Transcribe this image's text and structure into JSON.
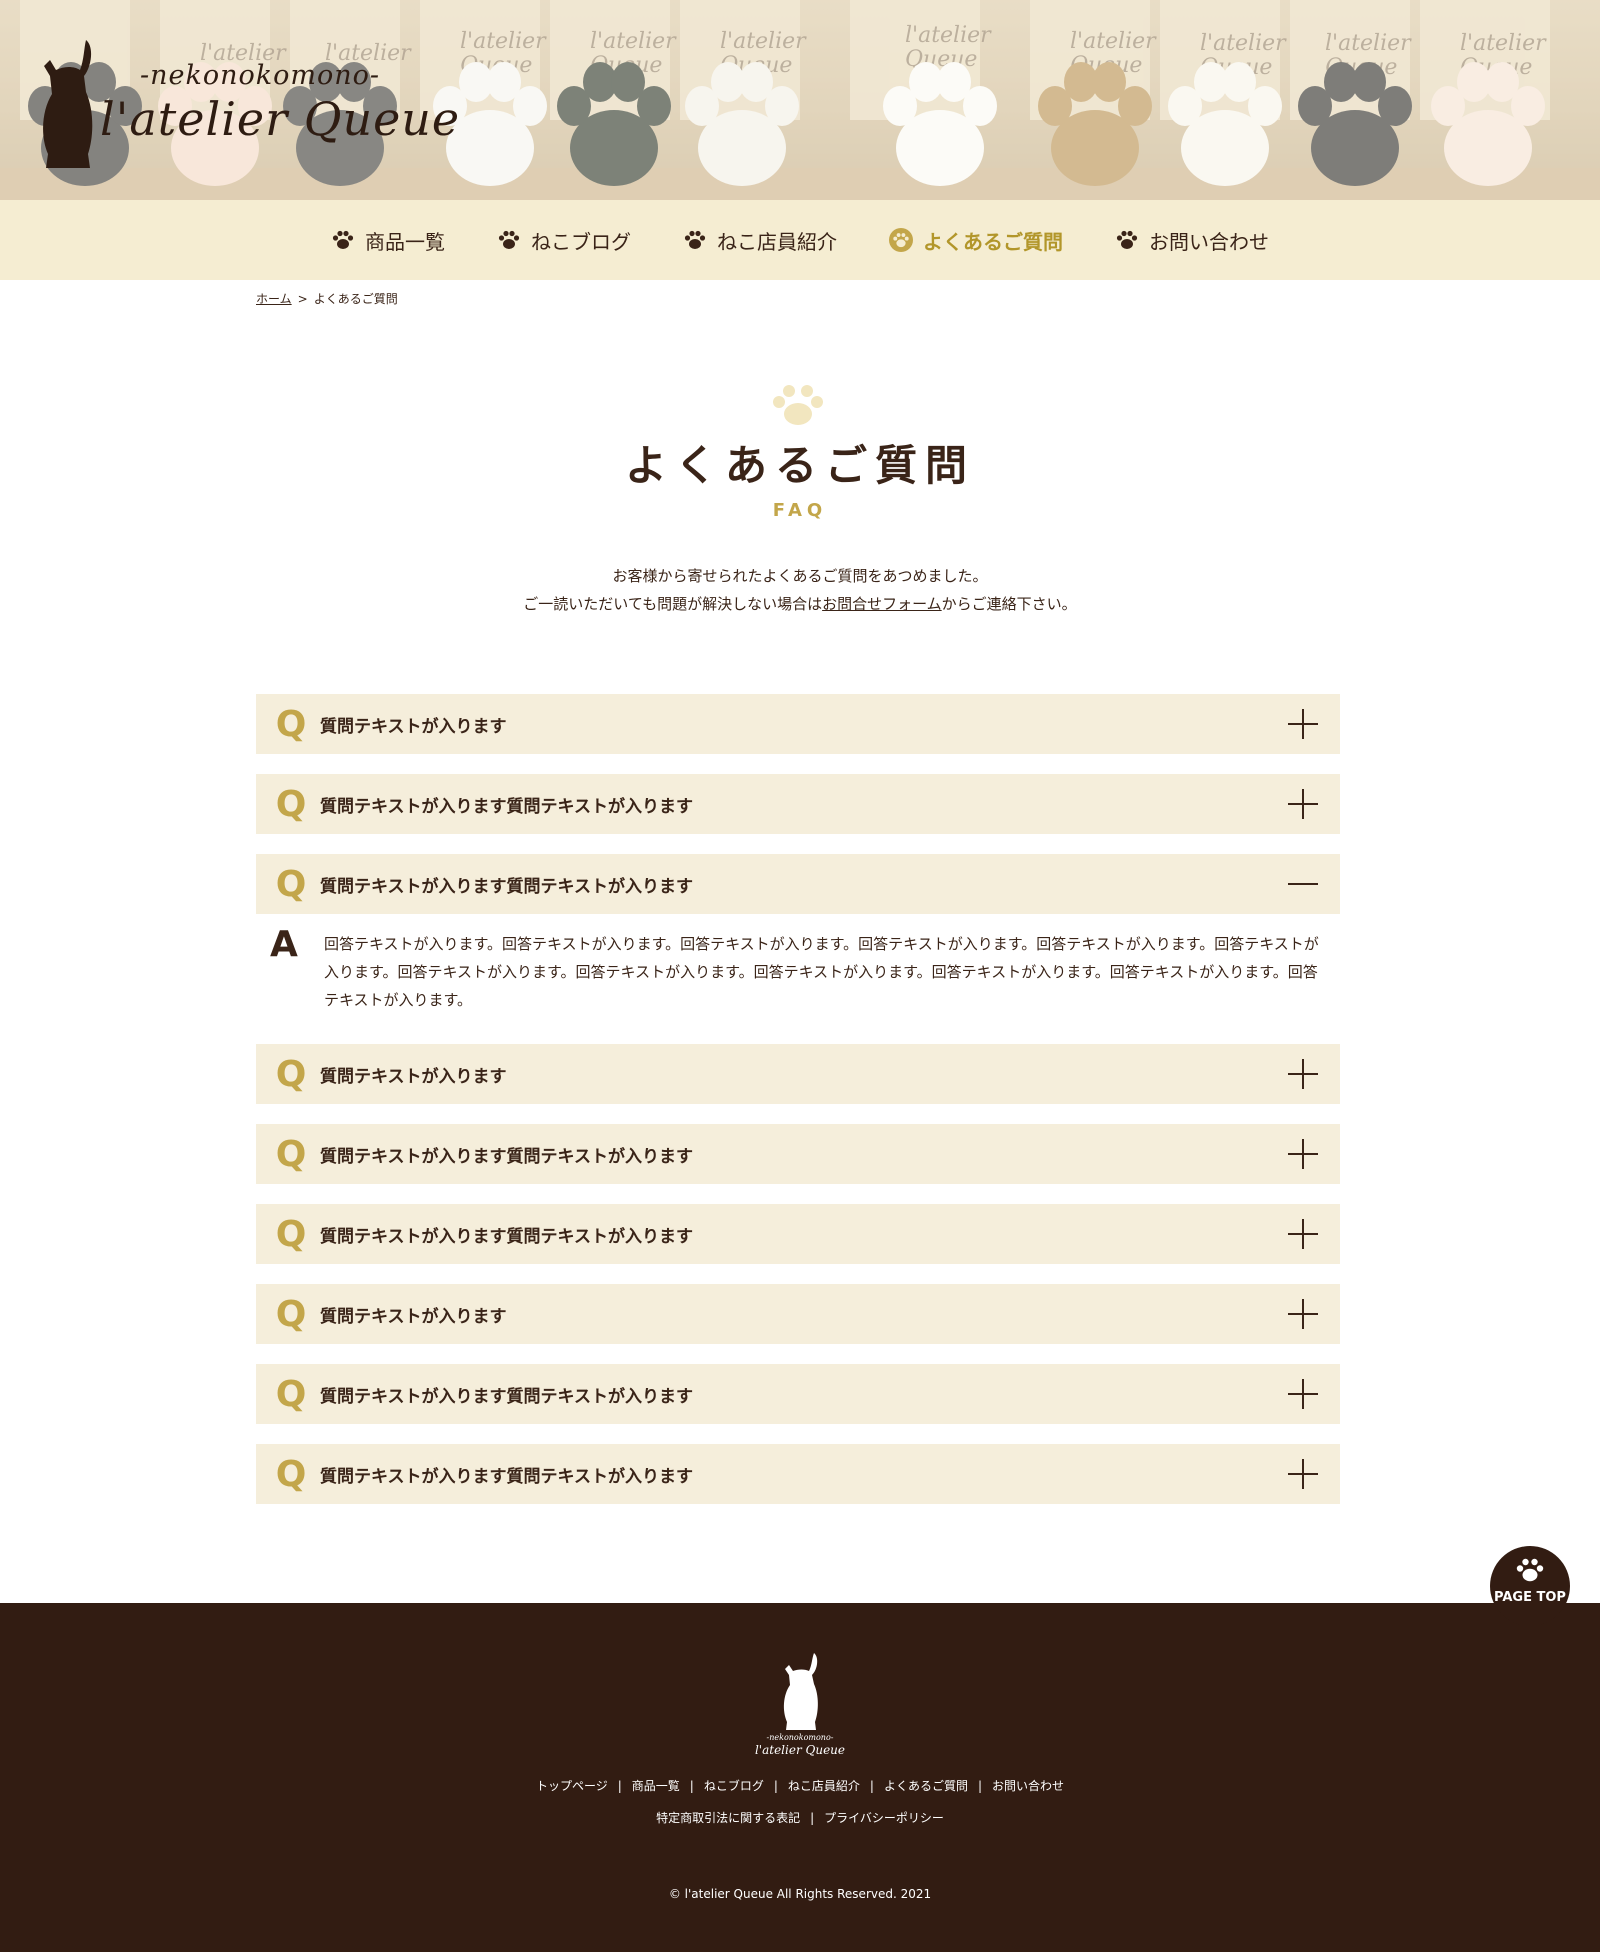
{
  "brand": {
    "tagline": "-nekonokomono-",
    "name": "l'atelier Queue"
  },
  "nav": {
    "items": [
      {
        "label": "商品一覧",
        "active": false
      },
      {
        "label": "ねこブログ",
        "active": false
      },
      {
        "label": "ねこ店員紹介",
        "active": false
      },
      {
        "label": "よくあるご質問",
        "active": true
      },
      {
        "label": "お問い合わせ",
        "active": false
      }
    ]
  },
  "breadcrumb": {
    "home": "ホーム",
    "separator": ">",
    "current": "よくあるご質問"
  },
  "heading": {
    "title": "よくあるご質問",
    "subtitle": "FAQ"
  },
  "intro": {
    "line1": "お客様から寄せられたよくあるご質問をあつめました。",
    "line2_before": "ご一読いただいても問題が解決しない場合は",
    "line2_link": "お問合せフォーム",
    "line2_after": "からご連絡下さい。"
  },
  "faq": {
    "q_mark": "Q",
    "a_mark": "A",
    "items": [
      {
        "question": "質問テキストが入ります",
        "expanded": false
      },
      {
        "question": "質問テキストが入ります質問テキストが入ります",
        "expanded": false
      },
      {
        "question": "質問テキストが入ります質問テキストが入ります",
        "expanded": true,
        "answer": "回答テキストが入ります。回答テキストが入ります。回答テキストが入ります。回答テキストが入ります。回答テキストが入ります。回答テキストが入ります。回答テキストが入ります。回答テキストが入ります。回答テキストが入ります。回答テキストが入ります。回答テキストが入ります。回答テキストが入ります。"
      },
      {
        "question": "質問テキストが入ります",
        "expanded": false
      },
      {
        "question": "質問テキストが入ります質問テキストが入ります",
        "expanded": false
      },
      {
        "question": "質問テキストが入ります質問テキストが入ります",
        "expanded": false
      },
      {
        "question": "質問テキストが入ります",
        "expanded": false
      },
      {
        "question": "質問テキストが入ります質問テキストが入ります",
        "expanded": false
      },
      {
        "question": "質問テキストが入ります質問テキストが入ります",
        "expanded": false
      }
    ]
  },
  "page_top": {
    "label": "PAGE TOP"
  },
  "footer": {
    "tagline": "-nekonokomono-",
    "name": "l'atelier Queue",
    "links": [
      "トップページ",
      "商品一覧",
      "ねこブログ",
      "ねこ店員紹介",
      "よくあるご質問",
      "お問い合わせ"
    ],
    "links2": [
      "特定商取引法に関する表記",
      "プライバシーポリシー"
    ],
    "separator": "|",
    "copyright": "© l'atelier Queue All Rights Reserved. 2021"
  },
  "colors": {
    "brand_brown": "#321c12",
    "text_brown": "#3a2418",
    "accent_gold": "#c3a64a",
    "nav_bg": "#f5edd2",
    "faq_bg": "#f5eedb"
  },
  "icons": {
    "nav": "paw-icon",
    "nav_active": "paw-circle-icon",
    "heading": "paw-icon",
    "collapsed": "plus-icon",
    "expanded": "minus-icon",
    "page_top": "paw-icon"
  }
}
